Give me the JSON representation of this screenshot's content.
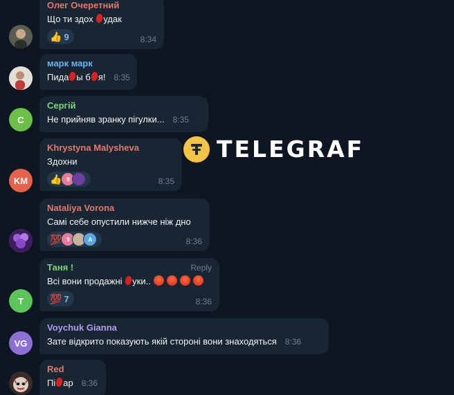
{
  "colors": {
    "background": "#0e1621",
    "bubble": "#182533",
    "time": "#6d7f8f",
    "reaction_bg": "#24364a",
    "reaction_count": "#7eb8ea"
  },
  "watermark": {
    "text": "TELEGRAF",
    "logo_icon": "telegraf-logo-icon"
  },
  "messages": [
    {
      "sender": "Олег Очеретний",
      "sender_color": "#e5786a",
      "text_before": "Що ти здох ",
      "text_after": "удак",
      "time": "8:34",
      "reaction": {
        "emoji": "👍",
        "count": "9"
      },
      "avatar": {
        "type": "photo",
        "icon": "person-photo-icon"
      }
    },
    {
      "sender": "марк марк",
      "sender_color": "#6ab3f3",
      "text_parts": [
        "Пида",
        "ы б",
        "я!"
      ],
      "time": "8:35",
      "avatar": {
        "type": "photo",
        "icon": "person-photo-icon"
      }
    },
    {
      "sender": "Сергій",
      "sender_color": "#7ed67a",
      "text": "Не прийняв зранку пігулки...",
      "time": "8:35",
      "avatar": {
        "type": "initials",
        "initials": "С",
        "color": "#6cc04a"
      }
    },
    {
      "sender": "Khrystyna Malysheva",
      "sender_color": "#e5786a",
      "text": "Здохни",
      "time": "8:35",
      "reaction": {
        "emoji": "👍",
        "users": [
          "9",
          ""
        ]
      },
      "avatar": {
        "type": "initials",
        "initials": "KM",
        "color": "#e7624c"
      }
    },
    {
      "sender": "Nataliya Vorona",
      "sender_color": "#e5786a",
      "text": "Самі себе опустили нижче ніж дно",
      "time": "8:36",
      "reaction": {
        "emoji": "💯",
        "users": [
          "9",
          "",
          "A"
        ]
      },
      "avatar": {
        "type": "photo",
        "icon": "flower-photo-icon"
      }
    },
    {
      "sender": "Таня !",
      "sender_color": "#7ed67a",
      "text_before": "Всі вони продажні ",
      "text_after": "уки..",
      "time": "8:36",
      "reply_label": "Reply",
      "reaction": {
        "emoji": "💯",
        "count": "7"
      },
      "avatar": {
        "type": "initials",
        "initials": "Т",
        "color": "#5cc55a"
      }
    },
    {
      "sender": "Voychuk Gianna",
      "sender_color": "#b39cf0",
      "text": "Зате відкрито показують якій стороні вони знаходяться",
      "time": "8:36",
      "avatar": {
        "type": "initials",
        "initials": "VG",
        "color": "#8e6fd6"
      }
    },
    {
      "sender": "Red",
      "sender_color": "#e5786a",
      "text_before": "Пі",
      "text_after": "ар",
      "time": "8:36",
      "avatar": {
        "type": "photo",
        "icon": "devil-mask-icon"
      }
    }
  ]
}
